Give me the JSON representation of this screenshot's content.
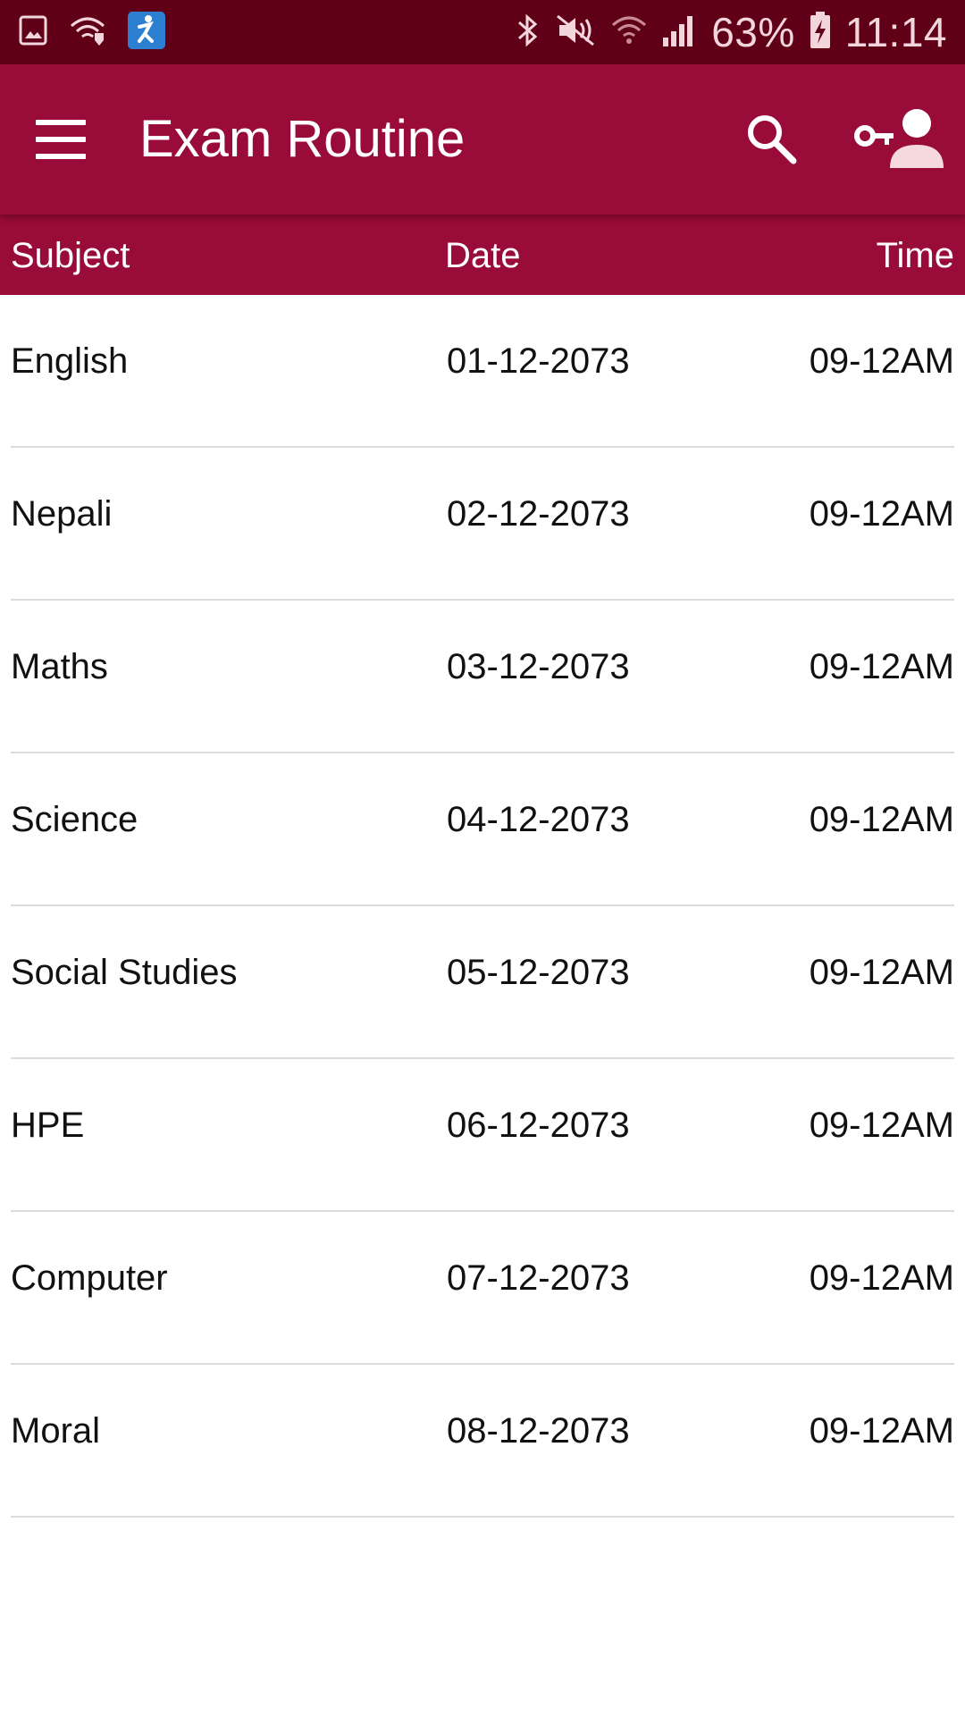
{
  "status_bar": {
    "battery": "63%",
    "time": "11:14",
    "icons": [
      "image-icon",
      "wifi-icon",
      "app-icon",
      "bluetooth-icon",
      "mute-icon",
      "wifi-signal-icon",
      "cell-signal-icon",
      "battery-charging-icon"
    ]
  },
  "app_bar": {
    "title": "Exam Routine",
    "menu_icon": "menu-icon",
    "search_icon": "search-icon",
    "account_icon": "account-key-icon"
  },
  "table": {
    "columns": [
      "Subject",
      "Date",
      "Time"
    ],
    "rows": [
      {
        "subject": "English",
        "date": "01-12-2073",
        "time": "09-12AM"
      },
      {
        "subject": "Nepali",
        "date": "02-12-2073",
        "time": "09-12AM"
      },
      {
        "subject": "Maths",
        "date": "03-12-2073",
        "time": "09-12AM"
      },
      {
        "subject": "Science",
        "date": "04-12-2073",
        "time": "09-12AM"
      },
      {
        "subject": "Social Studies",
        "date": "05-12-2073",
        "time": "09-12AM"
      },
      {
        "subject": "HPE",
        "date": "06-12-2073",
        "time": "09-12AM"
      },
      {
        "subject": "Computer",
        "date": "07-12-2073",
        "time": "09-12AM"
      },
      {
        "subject": "Moral",
        "date": "08-12-2073",
        "time": "09-12AM"
      }
    ]
  },
  "colors": {
    "status_bar": "#5f0017",
    "primary": "#990b39",
    "divider": "#dcdcdc"
  }
}
